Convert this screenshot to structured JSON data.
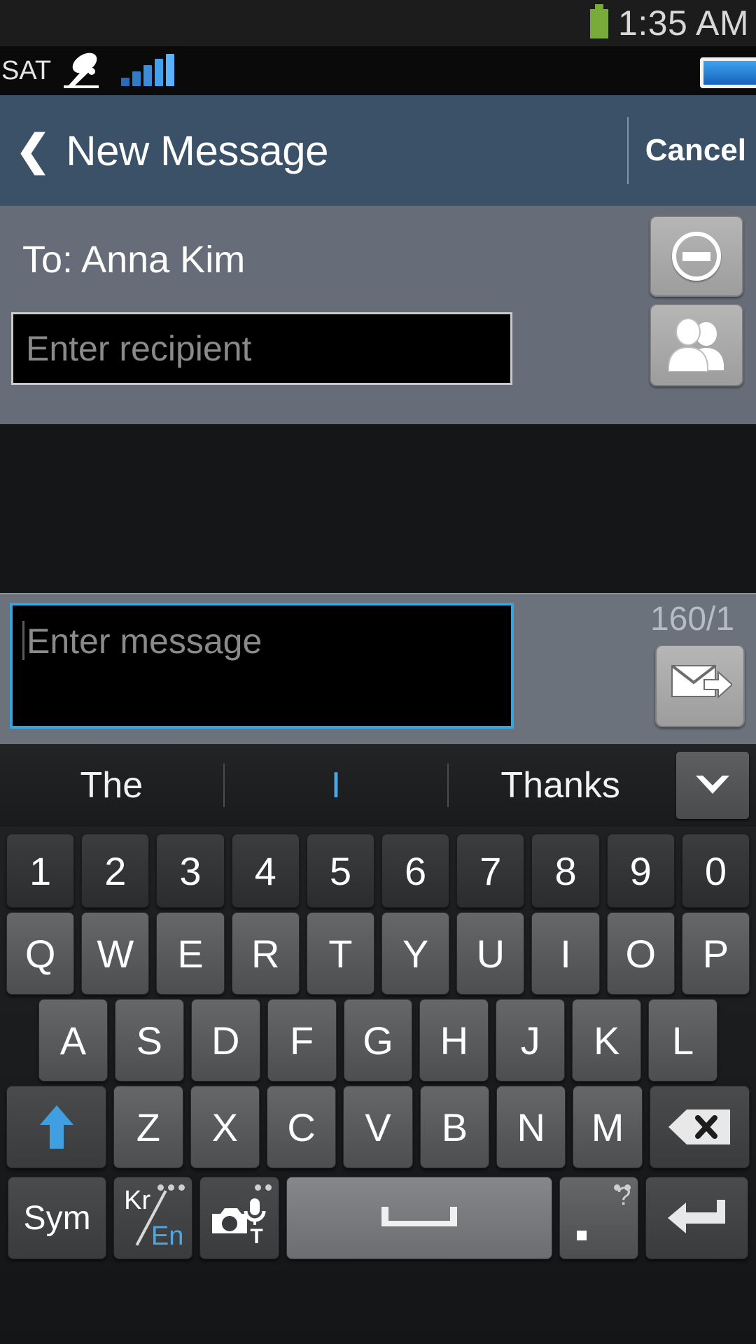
{
  "status_bar": {
    "time": "1:35 AM",
    "battery_icon": "battery-green-icon",
    "carrier_label": "SAT",
    "satellite_icon": "satellite-dish-icon",
    "signal_icon": "signal-bars-icon",
    "battery_blue_icon": "battery-blue-icon"
  },
  "header": {
    "back_icon": "back-chevron-icon",
    "title": "New Message",
    "cancel_label": "Cancel"
  },
  "recipient": {
    "to_label": "To: Anna Kim",
    "remove_icon": "minus-circle-icon",
    "input_placeholder": "Enter recipient",
    "input_value": "",
    "contacts_icon": "contacts-people-icon"
  },
  "compose": {
    "message_placeholder": "Enter message",
    "message_value": "",
    "char_counter": "160/1",
    "send_icon": "send-envelope-icon"
  },
  "suggestions": {
    "items": [
      {
        "label": "The",
        "active": false
      },
      {
        "label": "I",
        "active": true
      },
      {
        "label": "Thanks",
        "active": false
      }
    ],
    "expand_icon": "chevron-down-icon"
  },
  "keyboard": {
    "row_numbers": [
      "1",
      "2",
      "3",
      "4",
      "5",
      "6",
      "7",
      "8",
      "9",
      "0"
    ],
    "row_top": [
      "Q",
      "W",
      "E",
      "R",
      "T",
      "Y",
      "U",
      "I",
      "O",
      "P"
    ],
    "row_home": [
      "A",
      "S",
      "D",
      "F",
      "G",
      "H",
      "J",
      "K",
      "L"
    ],
    "row_bottom": [
      "Z",
      "X",
      "C",
      "V",
      "B",
      "N",
      "M"
    ],
    "shift_icon": "shift-arrow-up-icon",
    "backspace_icon": "backspace-delete-icon",
    "sym_label": "Sym",
    "lang_kr_label": "Kr",
    "lang_en_label": "En",
    "camera_icon": "camera-voice-input-icon",
    "camera_t_label": "T",
    "space_icon": "space-bar-icon",
    "period_label": ".",
    "period_hint": "?",
    "return_icon": "enter-return-icon"
  },
  "colors": {
    "header_bg": "#3a5168",
    "recipient_bg": "#666d78",
    "compose_bg": "#6b727c",
    "focus_border": "#37a4e0",
    "accent_blue": "#4aa8e8",
    "battery_green": "#79ab3b"
  }
}
